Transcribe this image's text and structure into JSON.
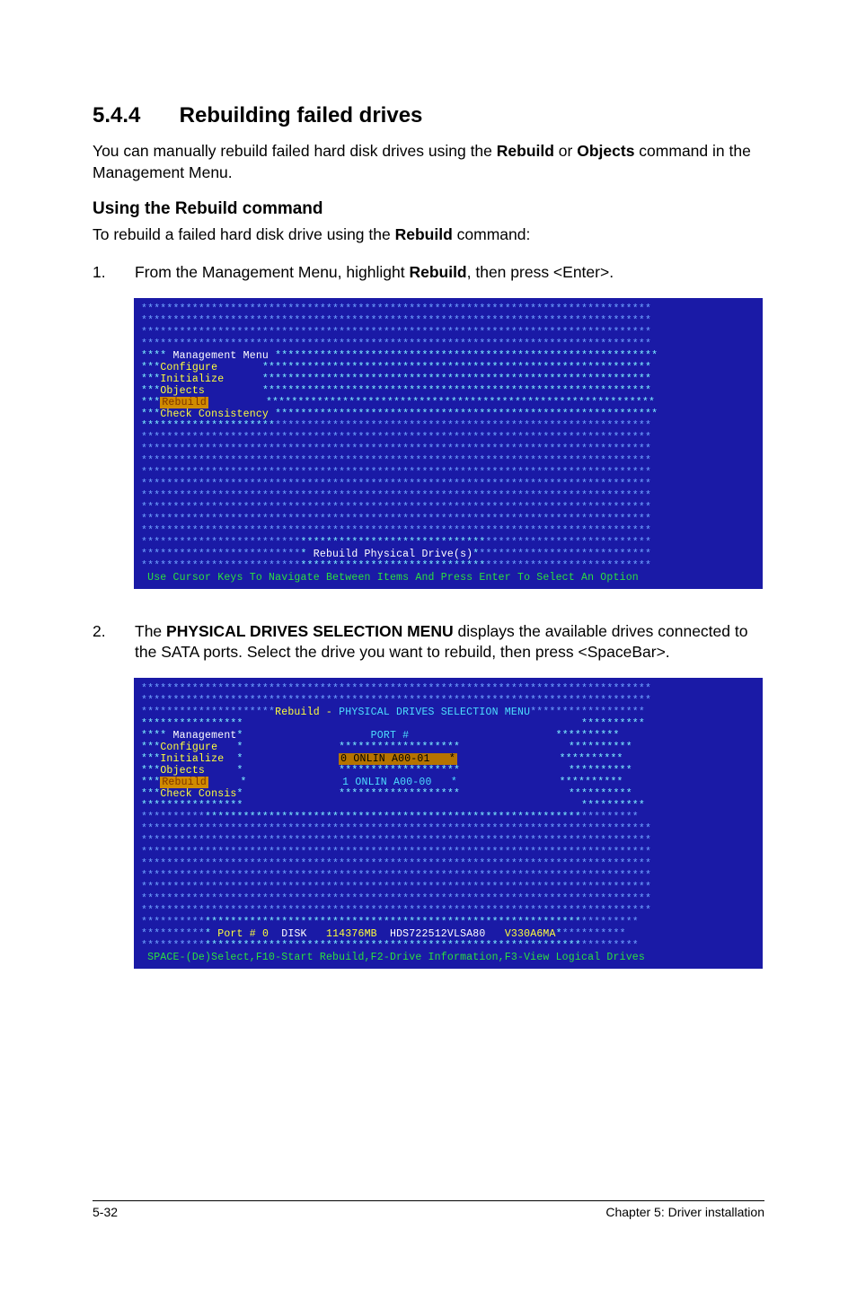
{
  "heading": {
    "number": "5.4.4",
    "title": "Rebuilding failed drives"
  },
  "intro_para": "You can manually rebuild failed hard disk drives using the Rebuild or Objects command in the Management Menu.",
  "intro_bold1": "Rebuild",
  "intro_bold2": "Objects",
  "sub_heading": "Using the Rebuild command",
  "sub_para": "To rebuild a failed hard disk drive using the Rebuild command:",
  "sub_bold": "Rebuild",
  "step1_text_prefix": "From the Management Menu, highlight ",
  "step1_bold": "Rebuild",
  "step1_text_suffix": ", then press <Enter>.",
  "step2_text_prefix": "The ",
  "step2_bold": "PHYSICAL DRIVES SELECTION MENU",
  "step2_text_suffix": " displays the available drives connected to the SATA ports. Select the drive you want to rebuild, then press <SpaceBar>.",
  "term1": {
    "menu_title": "Management Menu",
    "items": [
      "Configure",
      "Initialize",
      "Objects",
      "Rebuild",
      "Check Consistency"
    ],
    "banner": "Rebuild Physical Drive(s)",
    "statusbar": "Use Cursor Keys To Navigate Between Items And Press Enter To Select An Option"
  },
  "term2": {
    "title_prefix": "Rebuild - ",
    "title_main": "PHYSICAL DRIVES SELECTION MENU",
    "menu_title": "Management",
    "items": [
      "Configure",
      "Initialize",
      "Objects",
      "Rebuild",
      "Check Consis"
    ],
    "port_header": "PORT #",
    "port_rows": [
      {
        "n": "0",
        "state": "ONLIN A00-01"
      },
      {
        "n": "1",
        "state": "ONLIN A00-00"
      }
    ],
    "drive_row": {
      "port": "Port # 0",
      "type": "DISK",
      "size": "114376MB",
      "model": "HDS722512VLSA80",
      "serial": "V330A6MA"
    },
    "statusbar": "SPACE-(De)Select,F10-Start Rebuild,F2-Drive Information,F3-View Logical Drives"
  },
  "footer": {
    "left": "5-32",
    "right": "Chapter 5: Driver installation"
  }
}
